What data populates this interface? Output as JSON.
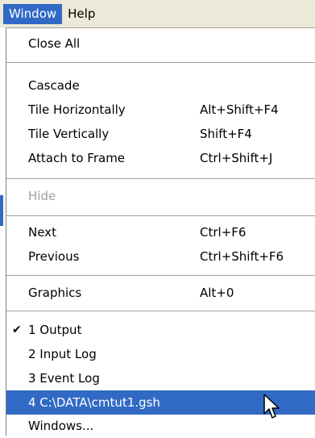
{
  "menubar": {
    "window_label": "Window",
    "help_label": "Help"
  },
  "menu": {
    "close_all": "Close All",
    "cascade": "Cascade",
    "tile_horizontally": "Tile Horizontally",
    "tile_horizontally_shortcut": "Alt+Shift+F4",
    "tile_vertically": "Tile Vertically",
    "tile_vertically_shortcut": "Shift+F4",
    "attach_to_frame": "Attach to Frame",
    "attach_to_frame_shortcut": "Ctrl+Shift+J",
    "hide": "Hide",
    "next": "Next",
    "next_shortcut": "Ctrl+F6",
    "previous": "Previous",
    "previous_shortcut": "Ctrl+Shift+F6",
    "graphics": "Graphics",
    "graphics_shortcut": "Alt+0",
    "window_list": [
      "1 Output",
      "2 Input Log",
      "3 Event Log",
      "4 C:\\DATA\\cmtut1.gsh"
    ],
    "windows_more": "Windows...",
    "check_glyph": "✔"
  },
  "colors": {
    "highlight": "#316ac5",
    "menubar_bg": "#ece9d8",
    "disabled_text": "#a0a0a0"
  },
  "icons": {
    "checkmark": "checkmark-icon",
    "cursor": "mouse-pointer-icon"
  }
}
